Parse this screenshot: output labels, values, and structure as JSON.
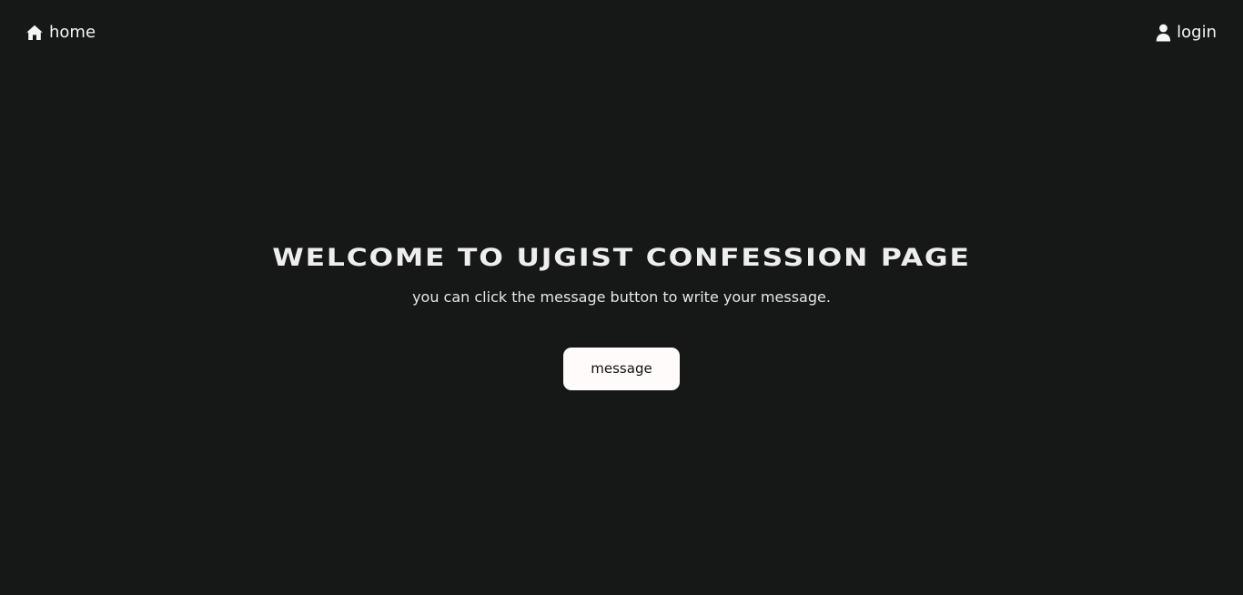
{
  "nav": {
    "home": {
      "label": "home",
      "icon": "home-icon"
    },
    "login": {
      "label": "login",
      "icon": "user-icon"
    }
  },
  "hero": {
    "title": "WELCOME TO UJGIST CONFESSION PAGE",
    "subtitle": "you can click the message button to write your message.",
    "button_label": "message"
  },
  "colors": {
    "background": "#161717",
    "text": "#f2f2f2",
    "button_bg": "#fffbfb",
    "button_text": "#111111"
  }
}
